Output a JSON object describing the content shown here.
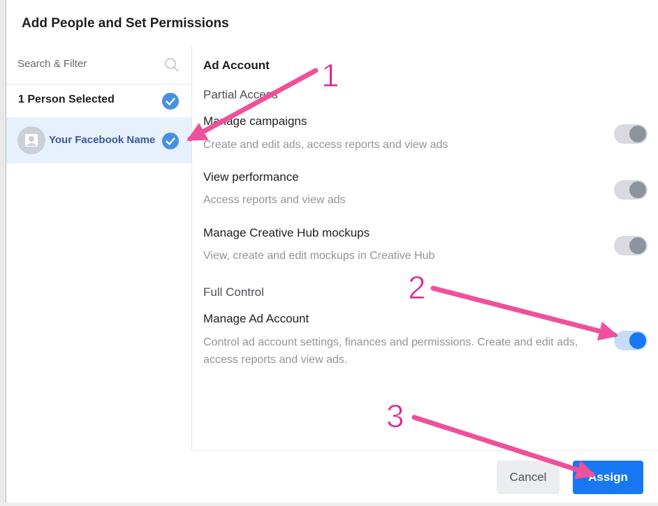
{
  "dialog": {
    "title": "Add People and Set Permissions"
  },
  "left_pane": {
    "search_placeholder": "Search & Filter",
    "selected_count_label": "1 Person Selected",
    "person": {
      "name": "Your Facebook Name",
      "selected": true
    }
  },
  "permissions": {
    "section_title": "Ad Account",
    "partial_access_label": "Partial Access",
    "full_control_label": "Full Control",
    "items": [
      {
        "title": "Manage campaigns",
        "description": "Create and edit ads, access reports and view ads",
        "enabled": false
      },
      {
        "title": "View performance",
        "description": "Access reports and view ads",
        "enabled": false
      },
      {
        "title": "Manage Creative Hub mockups",
        "description": "View, create and edit mockups in Creative Hub",
        "enabled": false
      },
      {
        "title": "Manage Ad Account",
        "description": "Control ad account settings, finances and permissions. Create and edit ads, access reports and view ads.",
        "enabled": true
      }
    ]
  },
  "footer": {
    "cancel_label": "Cancel",
    "assign_label": "Assign"
  },
  "annotations": {
    "step1": "1",
    "step2": "2",
    "step3": "3"
  },
  "colors": {
    "accent": "#1877f2",
    "arrow": "#f0509b",
    "selected_bg": "#e7f1fc"
  },
  "icons": {
    "search": "search-icon",
    "check": "check-circle-icon",
    "avatar": "avatar-placeholder-icon"
  }
}
